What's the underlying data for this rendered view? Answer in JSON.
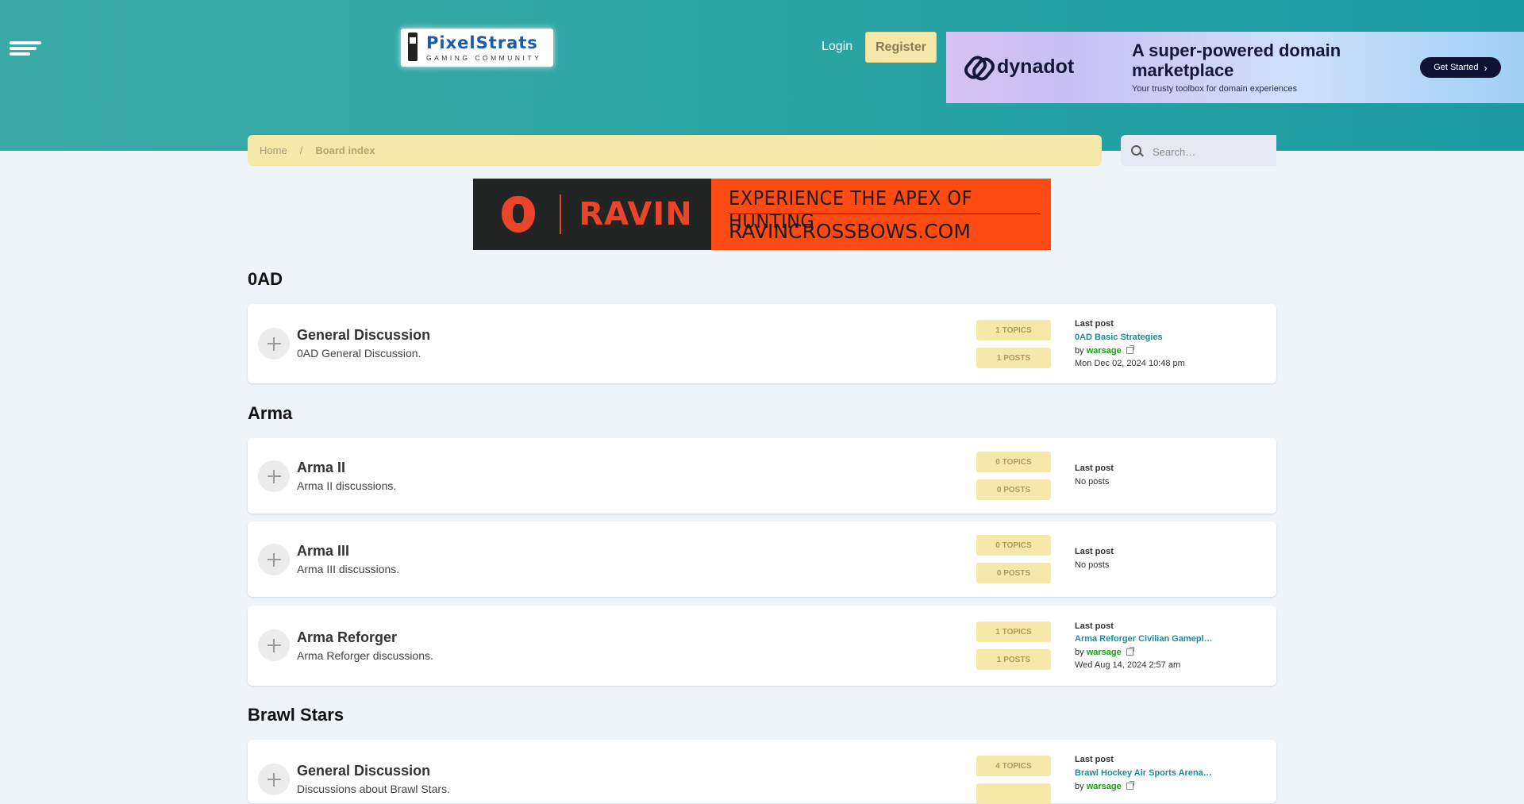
{
  "header": {
    "logo": {
      "main": "PixelStrats",
      "sub": "GAMING COMMUNITY"
    },
    "login_label": "Login",
    "register_label": "Register"
  },
  "ads": {
    "dynadot": {
      "brand": "dynadot",
      "headline": "A super-powered domain marketplace",
      "subline": "Your trusty toolbox for domain experiences",
      "cta": "Get Started"
    },
    "ravin": {
      "brand": "RAVIN",
      "line1": "EXPERIENCE THE APEX OF HUNTING",
      "line2": "RAVINCROSSBOWS.COM"
    }
  },
  "breadcrumb": {
    "home": "Home",
    "separator": "/",
    "current": "Board index"
  },
  "search": {
    "placeholder": "Search…"
  },
  "categories": [
    {
      "title": "0AD"
    },
    {
      "title": "Arma"
    },
    {
      "title": "Brawl Stars"
    }
  ],
  "forums": [
    {
      "title": "General Discussion",
      "desc": "0AD General Discussion.",
      "topics": "1 TOPICS",
      "posts": "1 POSTS",
      "last_label": "Last post",
      "last_topic": "0AD Basic Strategies",
      "by": "by",
      "user": "warsage",
      "date": "Mon Dec 02, 2024 10:48 pm"
    },
    {
      "title": "Arma II",
      "desc": "Arma II discussions.",
      "topics": "0 TOPICS",
      "posts": "0 POSTS",
      "last_label": "Last post",
      "none": "No posts"
    },
    {
      "title": "Arma III",
      "desc": "Arma III discussions.",
      "topics": "0 TOPICS",
      "posts": "0 POSTS",
      "last_label": "Last post",
      "none": "No posts"
    },
    {
      "title": "Arma Reforger",
      "desc": "Arma Reforger discussions.",
      "topics": "1 TOPICS",
      "posts": "1 POSTS",
      "last_label": "Last post",
      "last_topic": "Arma Reforger Civilian Gamepl…",
      "by": "by",
      "user": "warsage",
      "date": "Wed Aug 14, 2024 2:57 am"
    },
    {
      "title": "General Discussion",
      "desc": "Discussions about Brawl Stars.",
      "topics": "4 TOPICS",
      "posts": "",
      "last_label": "Last post",
      "last_topic": "Brawl Hockey Air Sports Arena…",
      "by": "by",
      "user": "warsage"
    }
  ],
  "colors": {
    "header_teal": "#2aa5a3",
    "accent_yellow": "#f6e8a8",
    "link_teal": "#1c8b9c",
    "user_green": "#14a014",
    "ravin_orange": "#ff4a14"
  }
}
